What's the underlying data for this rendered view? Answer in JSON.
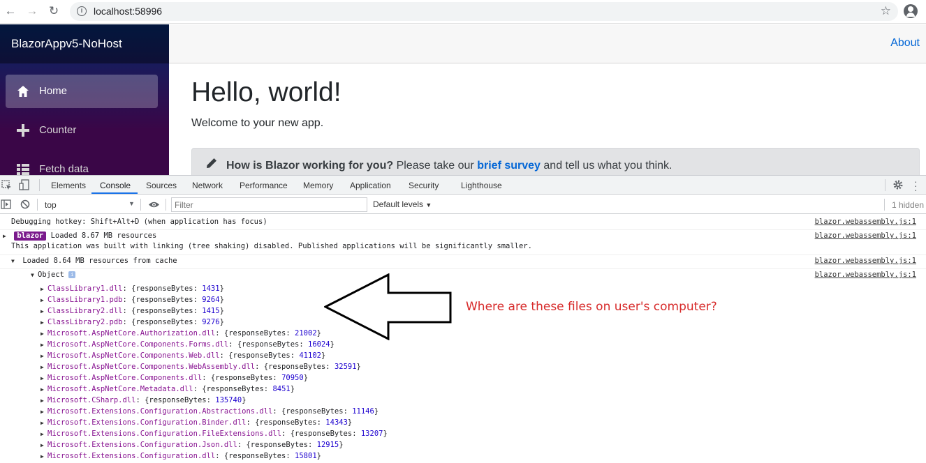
{
  "browser": {
    "url": "localhost:58996"
  },
  "app": {
    "brand": "BlazorAppv5-NoHost",
    "nav": [
      {
        "label": "Home",
        "icon": "home-icon",
        "active": true
      },
      {
        "label": "Counter",
        "icon": "plus-icon",
        "active": false
      },
      {
        "label": "Fetch data",
        "icon": "list-icon",
        "active": false
      }
    ],
    "top_link": "About",
    "heading": "Hello, world!",
    "welcome": "Welcome to your new app.",
    "survey": {
      "question": "How is Blazor working for you?",
      "pre": "Please take our",
      "link": "brief survey",
      "post": "and tell us what you think."
    }
  },
  "devtools": {
    "tabs": [
      "Elements",
      "Console",
      "Sources",
      "Network",
      "Performance",
      "Memory",
      "Application",
      "Security",
      "Lighthouse"
    ],
    "active_tab": "Console",
    "context": "top",
    "filter_placeholder": "Filter",
    "levels": "Default levels",
    "hidden": "1 hidden",
    "console": {
      "hotkey": "Debugging hotkey: Shift+Alt+D (when application has focus)",
      "badge": "blazor",
      "loaded": "Loaded 8.67 MB resources",
      "linking": "This application was built with linking (tree shaking) disabled. Published applications will be significantly smaller.",
      "cache": "Loaded 8.64 MB resources from cache",
      "object": "Object",
      "source": "blazor.webassembly.js:1",
      "prop_key": "responseBytes",
      "files": [
        {
          "name": "ClassLibrary1.dll",
          "bytes": "1431"
        },
        {
          "name": "ClassLibrary1.pdb",
          "bytes": "9264"
        },
        {
          "name": "ClassLibrary2.dll",
          "bytes": "1415"
        },
        {
          "name": "ClassLibrary2.pdb",
          "bytes": "9276"
        },
        {
          "name": "Microsoft.AspNetCore.Authorization.dll",
          "bytes": "21002"
        },
        {
          "name": "Microsoft.AspNetCore.Components.Forms.dll",
          "bytes": "16024"
        },
        {
          "name": "Microsoft.AspNetCore.Components.Web.dll",
          "bytes": "41102"
        },
        {
          "name": "Microsoft.AspNetCore.Components.WebAssembly.dll",
          "bytes": "32591"
        },
        {
          "name": "Microsoft.AspNetCore.Components.dll",
          "bytes": "70950"
        },
        {
          "name": "Microsoft.AspNetCore.Metadata.dll",
          "bytes": "8451"
        },
        {
          "name": "Microsoft.CSharp.dll",
          "bytes": "135740"
        },
        {
          "name": "Microsoft.Extensions.Configuration.Abstractions.dll",
          "bytes": "11146"
        },
        {
          "name": "Microsoft.Extensions.Configuration.Binder.dll",
          "bytes": "14343"
        },
        {
          "name": "Microsoft.Extensions.Configuration.FileExtensions.dll",
          "bytes": "13207"
        },
        {
          "name": "Microsoft.Extensions.Configuration.Json.dll",
          "bytes": "12915"
        },
        {
          "name": "Microsoft.Extensions.Configuration.dll",
          "bytes": "15801"
        }
      ]
    }
  },
  "annotation": "Where are these files on user's computer?"
}
